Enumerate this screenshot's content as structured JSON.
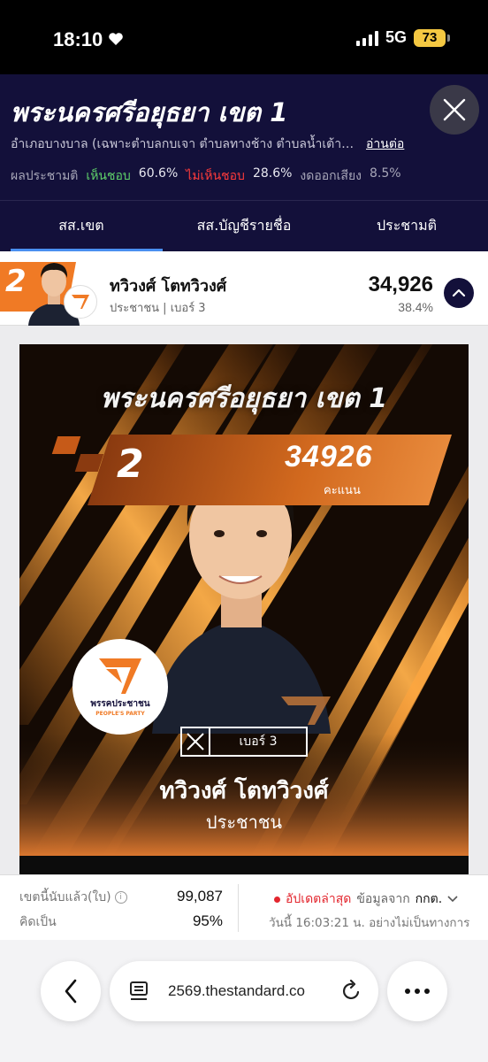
{
  "status_bar": {
    "time": "18:10",
    "network": "5G",
    "battery": "73"
  },
  "header": {
    "title": "พระนครศรีอยุธยา เขต 1",
    "subtitle": "อำเภอบางบาล (เฉพาะตำบลกบเจา ตำบลทางช้าง ตำบลน้ำเต้า ...",
    "read_more": "อ่านต่อ",
    "referendum_label": "ผลประชามติ",
    "yes_label": "เห็นชอบ",
    "yes_value": "60.6%",
    "no_label": "ไม่เห็นชอบ",
    "no_value": "28.6%",
    "abstain_label": "งดออกเสียง",
    "abstain_value": "8.5%"
  },
  "tabs": [
    {
      "label": "สส.เขต",
      "active": true
    },
    {
      "label": "สส.บัญชีรายชื่อ",
      "active": false
    },
    {
      "label": "ประชามติ",
      "active": false
    }
  ],
  "candidate": {
    "rank": "2",
    "name": "ทวิวงศ์ โตทวิวงศ์",
    "party_line": "ประชาชน | เบอร์ 3",
    "votes": "34,926",
    "percent": "38.4%"
  },
  "poster": {
    "title": "พระนครศรีอยุธยา เขต 1",
    "rank": "2",
    "score": "34926",
    "score_label": "คะแนน",
    "party_logo_name": "พรรคประชาชน",
    "party_logo_en": "PEOPLE'S PARTY",
    "ballot_label": "เบอร์ 3",
    "name": "ทวิวงศ์ โตทวิวงศ์",
    "party": "ประชาชน"
  },
  "stats": {
    "counted_label": "เขตนี้นับแล้ว(ใบ)",
    "counted_value": "99,087",
    "percent_label": "คิดเป็น",
    "percent_value": "95%",
    "update_label": "อัปเดตล่าสุด",
    "source_label": "ข้อมูลจาก",
    "source_name": "กกต.",
    "update_time": "วันนี้ 16:03:21 น. อย่างไม่เป็นทางการ"
  },
  "browser": {
    "url": "2569.thestandard.co"
  },
  "colors": {
    "navy": "#13103a",
    "orange": "#f07a25",
    "yes": "#5fd16a",
    "no": "#ff3b3b",
    "accent": "#4a8ff0"
  }
}
